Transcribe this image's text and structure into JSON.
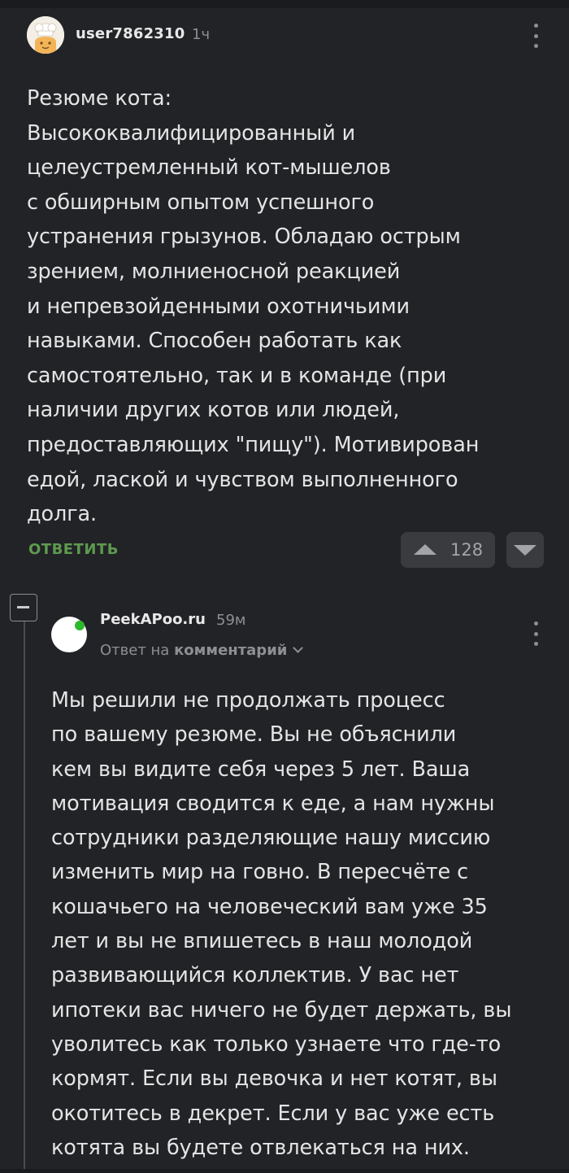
{
  "comment1": {
    "username": "user7862310",
    "time": "1ч",
    "body_lines": [
      "Резюме кота:",
      "Высококвалифицированный и",
      "целеустремленный кот-мышелов",
      "с обширным опытом успешного",
      "устранения грызунов. Обладаю острым",
      "зрением, молниеносной реакцией",
      "и непревзойденными охотничьими",
      "навыками. Способен работать как",
      "самостоятельно, так и в команде (при",
      "наличии других котов или людей,",
      "предоставляющих \"пищу\"). Мотивирован",
      "едой, лаской и чувством выполненного",
      "долга."
    ],
    "reply_label": "ОТВЕТИТЬ",
    "rating": "128",
    "avatar_icon": "chef-hat-avatar-icon"
  },
  "comment2": {
    "username": "PeekAPoo.ru",
    "time": "59м",
    "reply_prefix": "Ответ на",
    "reply_target": "комментарий",
    "online_color": "#2db82d",
    "body_lines": [
      "Мы решили не продолжать процесс",
      "по вашему резюме. Вы не объяснили",
      "кем вы видите себя через 5 лет. Ваша",
      "мотивация сводится к еде, а нам нужны",
      "сотрудники разделяющие нашу миссию",
      "изменить мир на говно. В пересчёте с",
      "кошачьего на человеческий вам уже 35",
      "лет и вы не впишетесь в наш молодой",
      "развивающийся коллектив. У вас нет",
      "ипотеки вас ничего не будет держать, вы",
      "уволитесь как только узнаете что где-то",
      "кормят. Если вы девочка и нет котят, вы",
      "окотитесь в декрет. Если у вас уже есть",
      "котята вы будете отвлекаться на них."
    ]
  },
  "colors": {
    "background": "#222327",
    "reply_link": "#5d9a4d",
    "muted": "#8d8f93",
    "vote_bg": "#3a3b3f"
  }
}
